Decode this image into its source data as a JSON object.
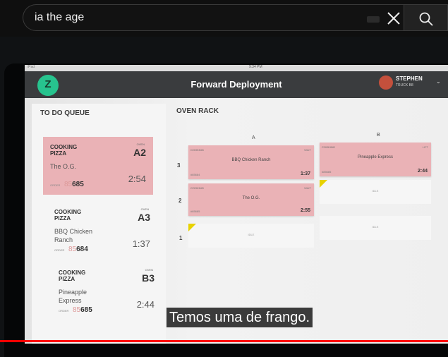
{
  "search": {
    "query": "ia the age"
  },
  "video": {
    "caption": "Temos uma de frango.",
    "progress_fraction": 1.0,
    "colors": {
      "progress": "#ff0000",
      "pink": "#eab2b6",
      "header": "#3a3c3e",
      "logo": "#27c38e"
    }
  },
  "device": {
    "status_time": "9:34 PM",
    "status_left": "iPad",
    "app_title": "Forward Deployment",
    "user": {
      "name": "STEPHEN",
      "subtitle": "TRUCK B8"
    },
    "queue": {
      "title": "TO DO QUEUE",
      "cards": [
        {
          "status": "COOKING PIZZA",
          "oven_label": "OVEN",
          "oven": "A2",
          "name": "The O.G.",
          "time": "2:54",
          "order_label": "ORDER",
          "order_prefix": "85",
          "order_num": "685"
        },
        {
          "status": "COOKING PIZZA",
          "oven_label": "OVEN",
          "oven": "A3",
          "name": "BBQ Chicken Ranch",
          "time": "1:37",
          "order_label": "ORDER",
          "order_prefix": "85",
          "order_num": "684"
        },
        {
          "status": "COOKING PIZZA",
          "oven_label": "OVEN",
          "oven": "B3",
          "name": "Pineapple Express",
          "time": "2:44",
          "order_label": "ORDER",
          "order_prefix": "85",
          "order_num": "685"
        }
      ]
    },
    "rack": {
      "title": "OVEN RACK",
      "columns": [
        "A",
        "B"
      ],
      "rows": [
        "3",
        "2",
        "1"
      ],
      "slots": [
        {
          "status": "COOKING",
          "hint": "WAIT",
          "name": "BBQ Chicken Ranch",
          "order": "#85684",
          "time": "1:37"
        },
        {
          "status": "COOKING",
          "hint": "LIFT",
          "name": "Pineapple Express",
          "order": "#85685",
          "time": "2:44"
        },
        {
          "status": "COOKING",
          "hint": "WAIT",
          "name": "The O.G.",
          "order": "#85685",
          "time": "2:55"
        }
      ],
      "empty_label": "IDLE"
    }
  }
}
